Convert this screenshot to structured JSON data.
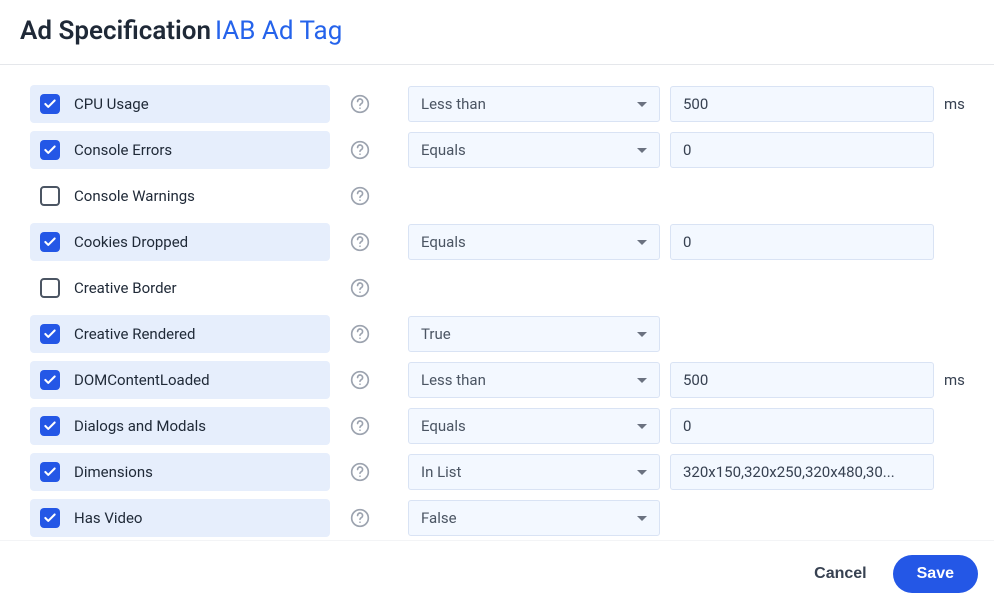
{
  "header": {
    "title": "Ad Specification",
    "subtitle": "IAB Ad Tag"
  },
  "rows": [
    {
      "checked": true,
      "label": "CPU Usage",
      "op": "Less than",
      "value": "500",
      "suffix": "ms"
    },
    {
      "checked": true,
      "label": "Console Errors",
      "op": "Equals",
      "value": "0"
    },
    {
      "checked": false,
      "label": "Console Warnings"
    },
    {
      "checked": true,
      "label": "Cookies Dropped",
      "op": "Equals",
      "value": "0"
    },
    {
      "checked": false,
      "label": "Creative Border"
    },
    {
      "checked": true,
      "label": "Creative Rendered",
      "op": "True"
    },
    {
      "checked": true,
      "label": "DOMContentLoaded",
      "op": "Less than",
      "value": "500",
      "suffix": "ms"
    },
    {
      "checked": true,
      "label": "Dialogs and Modals",
      "op": "Equals",
      "value": "0"
    },
    {
      "checked": true,
      "label": "Dimensions",
      "op": "In List",
      "value": "320x150,320x250,320x480,30..."
    },
    {
      "checked": true,
      "label": "Has Video",
      "op": "False"
    }
  ],
  "footer": {
    "cancel": "Cancel",
    "save": "Save"
  }
}
